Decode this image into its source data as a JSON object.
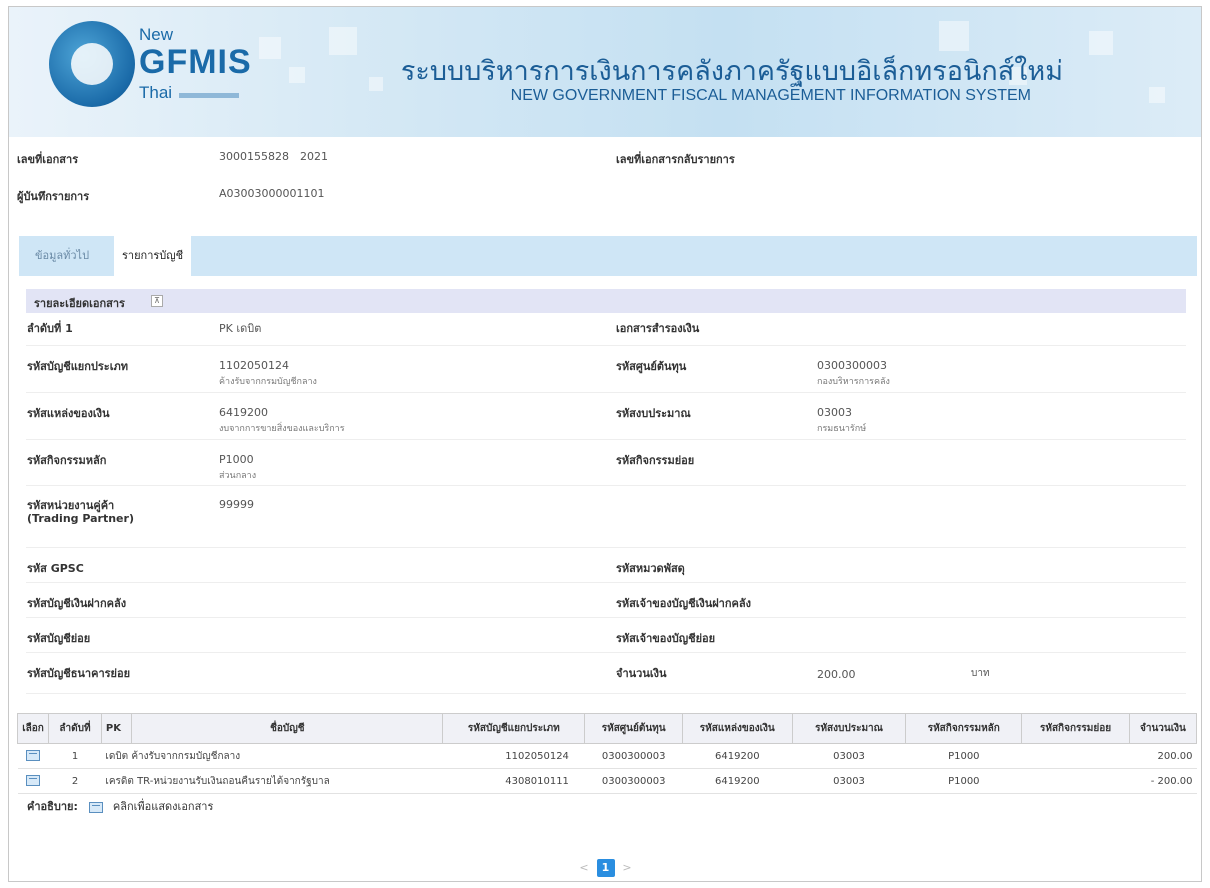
{
  "header": {
    "logo_new": "New",
    "logo_gfmis": "GFMIS",
    "logo_thai": "Thai",
    "title_th": "ระบบบริหารการเงินการคลังภาครัฐแบบอิเล็กทรอนิกส์ใหม่",
    "title_en": "NEW GOVERNMENT FISCAL MANAGEMENT INFORMATION SYSTEM"
  },
  "doc": {
    "doc_no_label": "เลขที่เอกสาร",
    "doc_no": "3000155828",
    "doc_year": "2021",
    "reverse_label": "เลขที่เอกสารกลับรายการ",
    "recorder_label": "ผู้บันทึกรายการ",
    "recorder": "A03003000001101"
  },
  "tabs": [
    {
      "label": "ข้อมูลทั่วไป",
      "active": false
    },
    {
      "label": "รายการบัญชี",
      "active": true
    }
  ],
  "section": {
    "title": "รายละเอียดเอกสาร",
    "collapse_icon": "⊼"
  },
  "detail": {
    "seq_label": "ลำดับที่ 1",
    "pk_value": "PK  เดบิต",
    "reserve_doc_label": "เอกสารสำรองเงิน",
    "gl_label": "รหัสบัญชีแยกประเภท",
    "gl_code": "1102050124",
    "gl_name": "ค้างรับจากกรมบัญชีกลาง",
    "cost_center_label": "รหัสศูนย์ต้นทุน",
    "cost_center_code": "0300300003",
    "cost_center_name": "กองบริหารการคลัง",
    "fund_label": "รหัสแหล่งของเงิน",
    "fund_code": "6419200",
    "fund_name": "งบจากการขายสิ่งของและบริการ",
    "budget_label": "รหัสงบประมาณ",
    "budget_code": "03003",
    "budget_name": "กรมธนารักษ์",
    "main_activity_label": "รหัสกิจกรรมหลัก",
    "main_activity_code": "P1000",
    "main_activity_name": "ส่วนกลาง",
    "sub_activity_label": "รหัสกิจกรรมย่อย",
    "trading_label_1": "รหัสหน่วยงานคู่ค้า",
    "trading_label_2": "(Trading Partner)",
    "trading_code": "99999",
    "gpsc_label": "รหัส GPSC",
    "material_label": "รหัสหมวดพัสดุ",
    "deposit_label": "รหัสบัญชีเงินฝากคลัง",
    "deposit_owner_label": "รหัสเจ้าของบัญชีเงินฝากคลัง",
    "sub_account_label": "รหัสบัญชีย่อย",
    "sub_account_owner_label": "รหัสเจ้าของบัญชีย่อย",
    "bank_sub_label": "รหัสบัญชีธนาคารย่อย",
    "amount_label": "จำนวนเงิน",
    "amount": "200.00",
    "currency": "บาท"
  },
  "table": {
    "headers": [
      "เลือก",
      "ลำดับที่",
      "PK",
      "ชื่อบัญชี",
      "รหัสบัญชีแยกประเภท",
      "รหัสศูนย์ต้นทุน",
      "รหัสแหล่งของเงิน",
      "รหัสงบประมาณ",
      "รหัสกิจกรรมหลัก",
      "รหัสกิจกรรมย่อย",
      "จำนวนเงิน"
    ],
    "rows": [
      {
        "seq": "1",
        "pk": "เดบิต",
        "name": "ค้างรับจากกรมบัญชีกลาง",
        "gl": "1102050124",
        "cc": "0300300003",
        "fund": "6419200",
        "budget": "03003",
        "main": "P1000",
        "sub": "",
        "amount": "200.00"
      },
      {
        "seq": "2",
        "pk": "เครดิต",
        "name": "TR-หน่วยงานรับเงินถอนคืนรายได้จากรัฐบาล",
        "gl": "4308010111",
        "cc": "0300300003",
        "fund": "6419200",
        "budget": "03003",
        "main": "P1000",
        "sub": "",
        "amount": "- 200.00"
      }
    ]
  },
  "legend": {
    "label": "คำอธิบาย:",
    "text": "คลิกเพื่อแสดงเอกสาร",
    "icon": "document-icon"
  },
  "pager": {
    "prev": "<",
    "current": "1",
    "next": ">"
  },
  "colors": {
    "header_blue": "#1b5d96",
    "tab_bar": "#cfe6f6",
    "section_bar": "#e2e4f5",
    "pager_active": "#2a8ee0"
  }
}
